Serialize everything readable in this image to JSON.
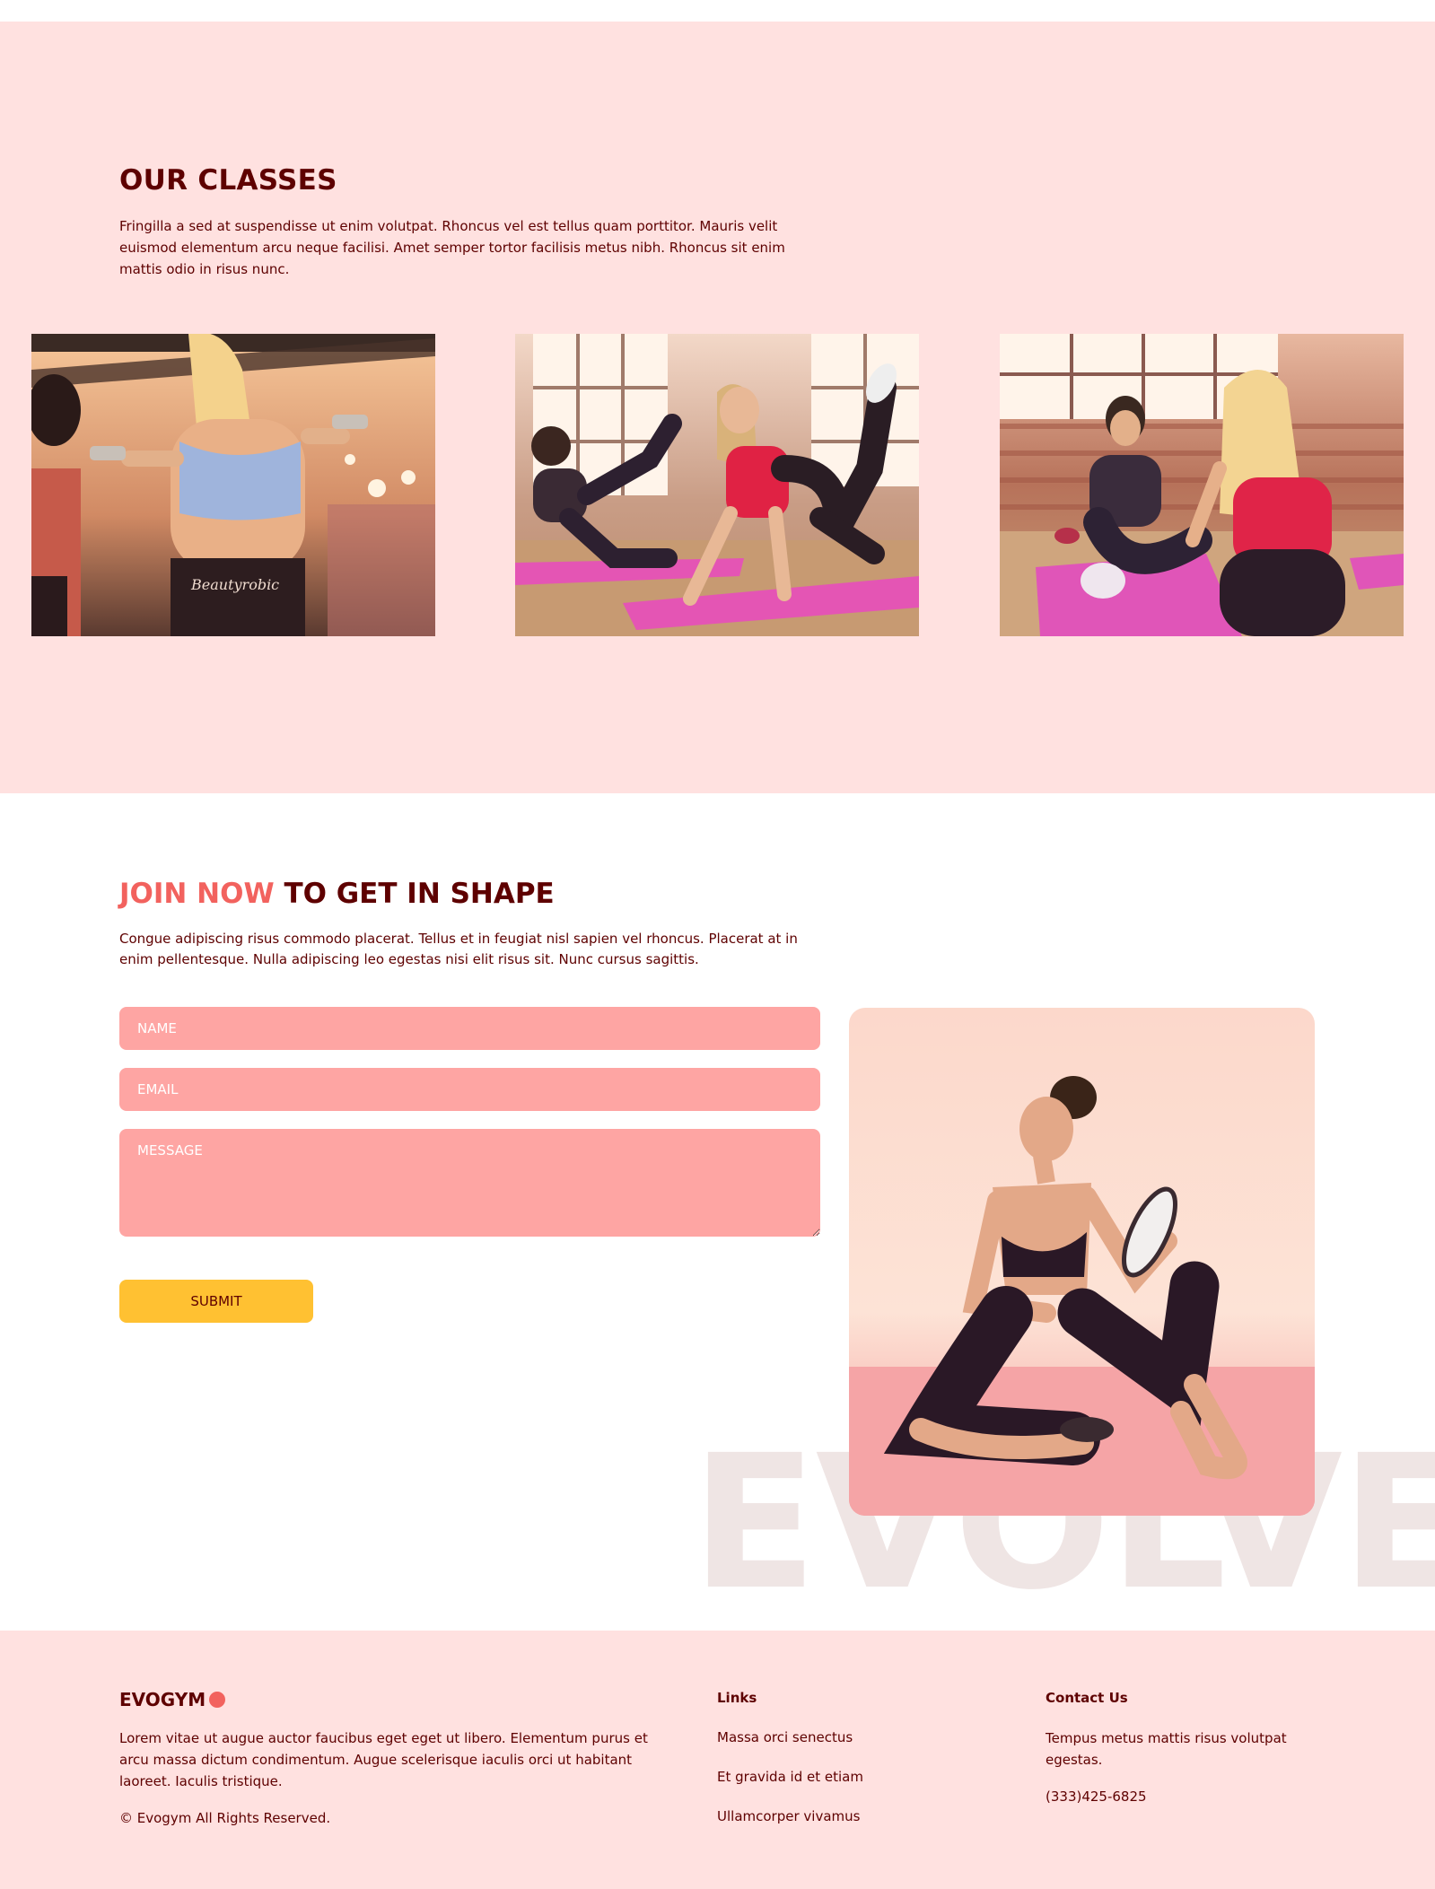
{
  "classes": {
    "title": "OUR CLASSES",
    "description": "Fringilla a sed at suspendisse ut enim volutpat. Rhoncus vel est tellus quam porttitor. Mauris velit euismod elementum arcu neque facilisi. Amet semper tortor facilisis metus nibh. Rhoncus sit enim mattis odio in risus nunc.",
    "images": [
      "dumbbell-class-image",
      "mat-workout-class-image",
      "stretching-class-image"
    ]
  },
  "join": {
    "title_accent": "JOIN NOW",
    "title_rest": " TO GET IN SHAPE",
    "description": "Congue adipiscing risus commodo placerat. Tellus et in feugiat nisl sapien vel rhoncus. Placerat at in enim pellentesque. Nulla adipiscing leo egestas nisi elit risus sit. Nunc cursus sagittis.",
    "name_placeholder": "NAME",
    "email_placeholder": "EMAIL",
    "message_placeholder": "MESSAGE",
    "submit_label": "SUBMIT",
    "watermark": "EVOLVE"
  },
  "footer": {
    "logo": "EVOGYM",
    "about": "Lorem vitae ut augue auctor faucibus eget eget ut libero. Elementum purus et arcu massa dictum condimentum. Augue scelerisque iaculis orci ut habitant laoreet. Iaculis tristique.",
    "copyright": "© Evogym All Rights Reserved.",
    "links_heading": "Links",
    "links": [
      "Massa orci senectus",
      "Et gravida id et etiam",
      "Ullamcorper vivamus"
    ],
    "contact_heading": "Contact Us",
    "contact_address": "Tempus metus mattis risus volutpat egestas.",
    "contact_phone": "(333)425-6825"
  },
  "colors": {
    "primary_bg": "#ffe1e0",
    "secondary": "#f2625e",
    "text": "#5e0000",
    "input": "#fea5a3",
    "button": "#ffc132",
    "watermark": "#efe5e4"
  }
}
